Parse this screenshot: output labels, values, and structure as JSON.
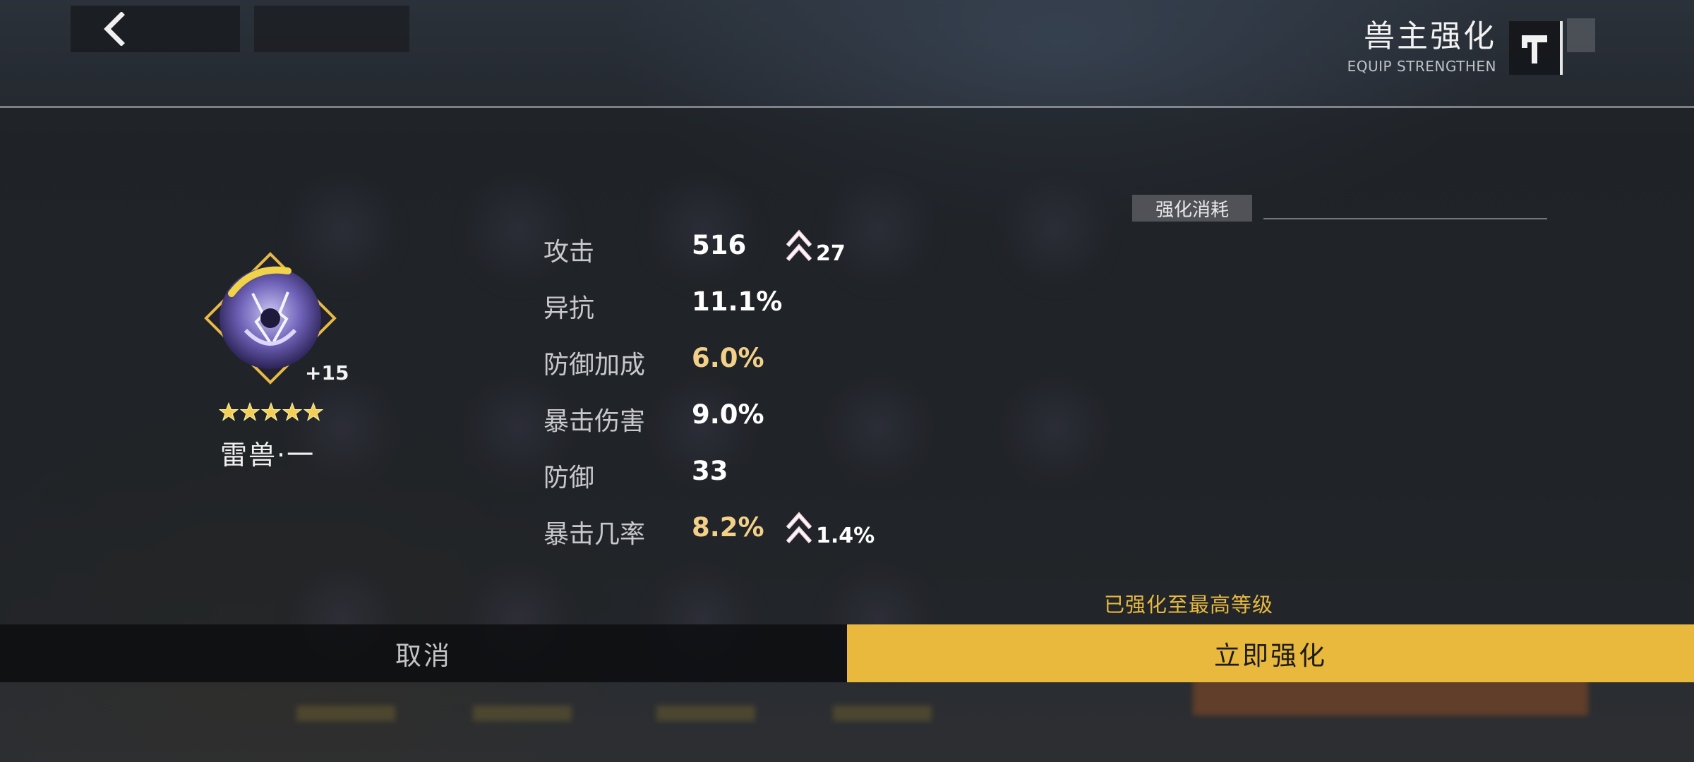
{
  "header": {
    "title": "兽主强化",
    "subtitle": "EQUIP STRENGTHEN",
    "back_icon": "chevron-left-icon",
    "hammer_icon": "hammer-icon"
  },
  "equipment": {
    "name": "雷兽·一",
    "level": "+15",
    "stars": 5,
    "icon": "thunder-beast-emblem-icon"
  },
  "stats": [
    {
      "label": "攻击",
      "value": "516",
      "highlight": false,
      "increase": "27"
    },
    {
      "label": "异抗",
      "value": "11.1%",
      "highlight": false,
      "increase": ""
    },
    {
      "label": "防御加成",
      "value": "6.0%",
      "highlight": true,
      "increase": ""
    },
    {
      "label": "暴击伤害",
      "value": "9.0%",
      "highlight": false,
      "increase": ""
    },
    {
      "label": "防御",
      "value": "33",
      "highlight": false,
      "increase": ""
    },
    {
      "label": "暴击几率",
      "value": "8.2%",
      "highlight": true,
      "increase": "1.4%"
    }
  ],
  "cost": {
    "label": "强化消耗"
  },
  "status_message": "已强化至最高等级",
  "buttons": {
    "cancel": "取消",
    "confirm": "立即强化"
  },
  "colors": {
    "accent": "#e8b93c",
    "gold_value": "#f3d08a",
    "status": "#e7b93f"
  }
}
